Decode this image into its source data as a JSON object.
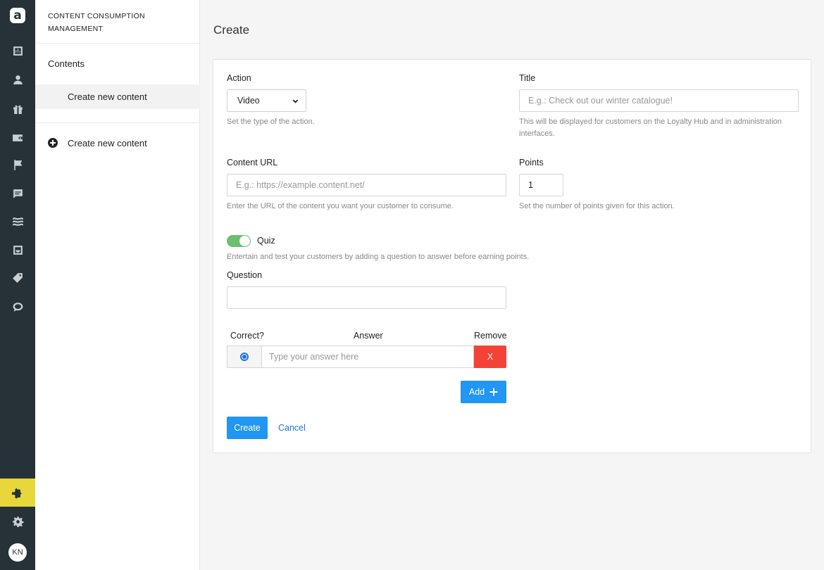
{
  "rail": {
    "logo_letter": "a",
    "icons": [
      "dashboard-icon",
      "customers-icon",
      "rewards-icon",
      "wallet-icon",
      "campaigns-flag-icon",
      "messages-icon",
      "streams-icon",
      "store-icon",
      "coupons-icon",
      "chat-icon",
      "plugins-puzzle-icon",
      "settings-gear-icon"
    ],
    "active_icon": "plugins-puzzle-icon",
    "avatar_initials": "KN",
    "active_color": "#e7d73a",
    "background_color": "#263238"
  },
  "subnav": {
    "module_title_line1": "CONTENT CONSUMPTION",
    "module_title_line2": "MANAGEMENT",
    "section_label": "Contents",
    "active_item": "Create new content",
    "create_link": "Create new content"
  },
  "page": {
    "title": "Create"
  },
  "form": {
    "action": {
      "label": "Action",
      "value": "Video",
      "help": "Set the type of the action."
    },
    "title": {
      "label": "Title",
      "placeholder": "E.g.: Check out our winter catalogue!",
      "help": "This will be displayed for customers on the Loyalty Hub and in administration interfaces."
    },
    "content_url": {
      "label": "Content URL",
      "placeholder": "E.g.: https://example.content.net/",
      "help": "Enter the URL of the content you want your customer to consume."
    },
    "points": {
      "label": "Points",
      "value": "1",
      "help": "Set the number of points given for this action."
    },
    "quiz": {
      "label": "Quiz",
      "enabled": true,
      "help": "Entertain and test your customers by adding a question to answer before earning points."
    },
    "question": {
      "label": "Question",
      "value": ""
    },
    "answers": {
      "header_correct": "Correct?",
      "header_answer": "Answer",
      "header_remove": "Remove",
      "rows": [
        {
          "correct": true,
          "placeholder": "Type your answer here",
          "remove_label": "X"
        }
      ]
    },
    "add_label": "Add",
    "create_label": "Create",
    "cancel_label": "Cancel",
    "accent_color": "#2196f3",
    "danger_color": "#f44336",
    "toggle_color": "#6bbf6d"
  }
}
